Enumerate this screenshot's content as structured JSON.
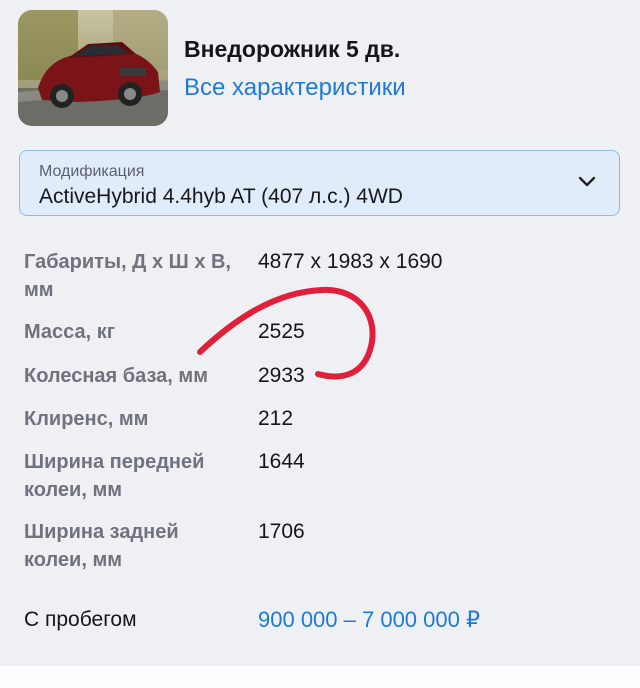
{
  "header": {
    "title": "Внедорожник 5 дв.",
    "specs_link": "Все характеристики"
  },
  "modification": {
    "label": "Модификация",
    "value": "ActiveHybrid 4.4hyb AT (407 л.с.) 4WD"
  },
  "specs": [
    {
      "key": "Габариты, Д х Ш х В, мм",
      "value": "4877 x 1983 x 1690"
    },
    {
      "key": "Масса, кг",
      "value": "2525"
    },
    {
      "key": "Колесная база, мм",
      "value": "2933"
    },
    {
      "key": "Клиренс, мм",
      "value": "212"
    },
    {
      "key": "Ширина передней колеи, мм",
      "value": "1644"
    },
    {
      "key": "Ширина задней колеи, мм",
      "value": "1706"
    }
  ],
  "price": {
    "label": "С пробегом",
    "range": "900 000 – 7 000 000 ₽"
  },
  "colors": {
    "accent": "#1f7ad6",
    "select_bg": "#e1ecfb",
    "annotation": "#e0203a"
  },
  "icons": {
    "dropdown": "chevron-down-icon"
  }
}
